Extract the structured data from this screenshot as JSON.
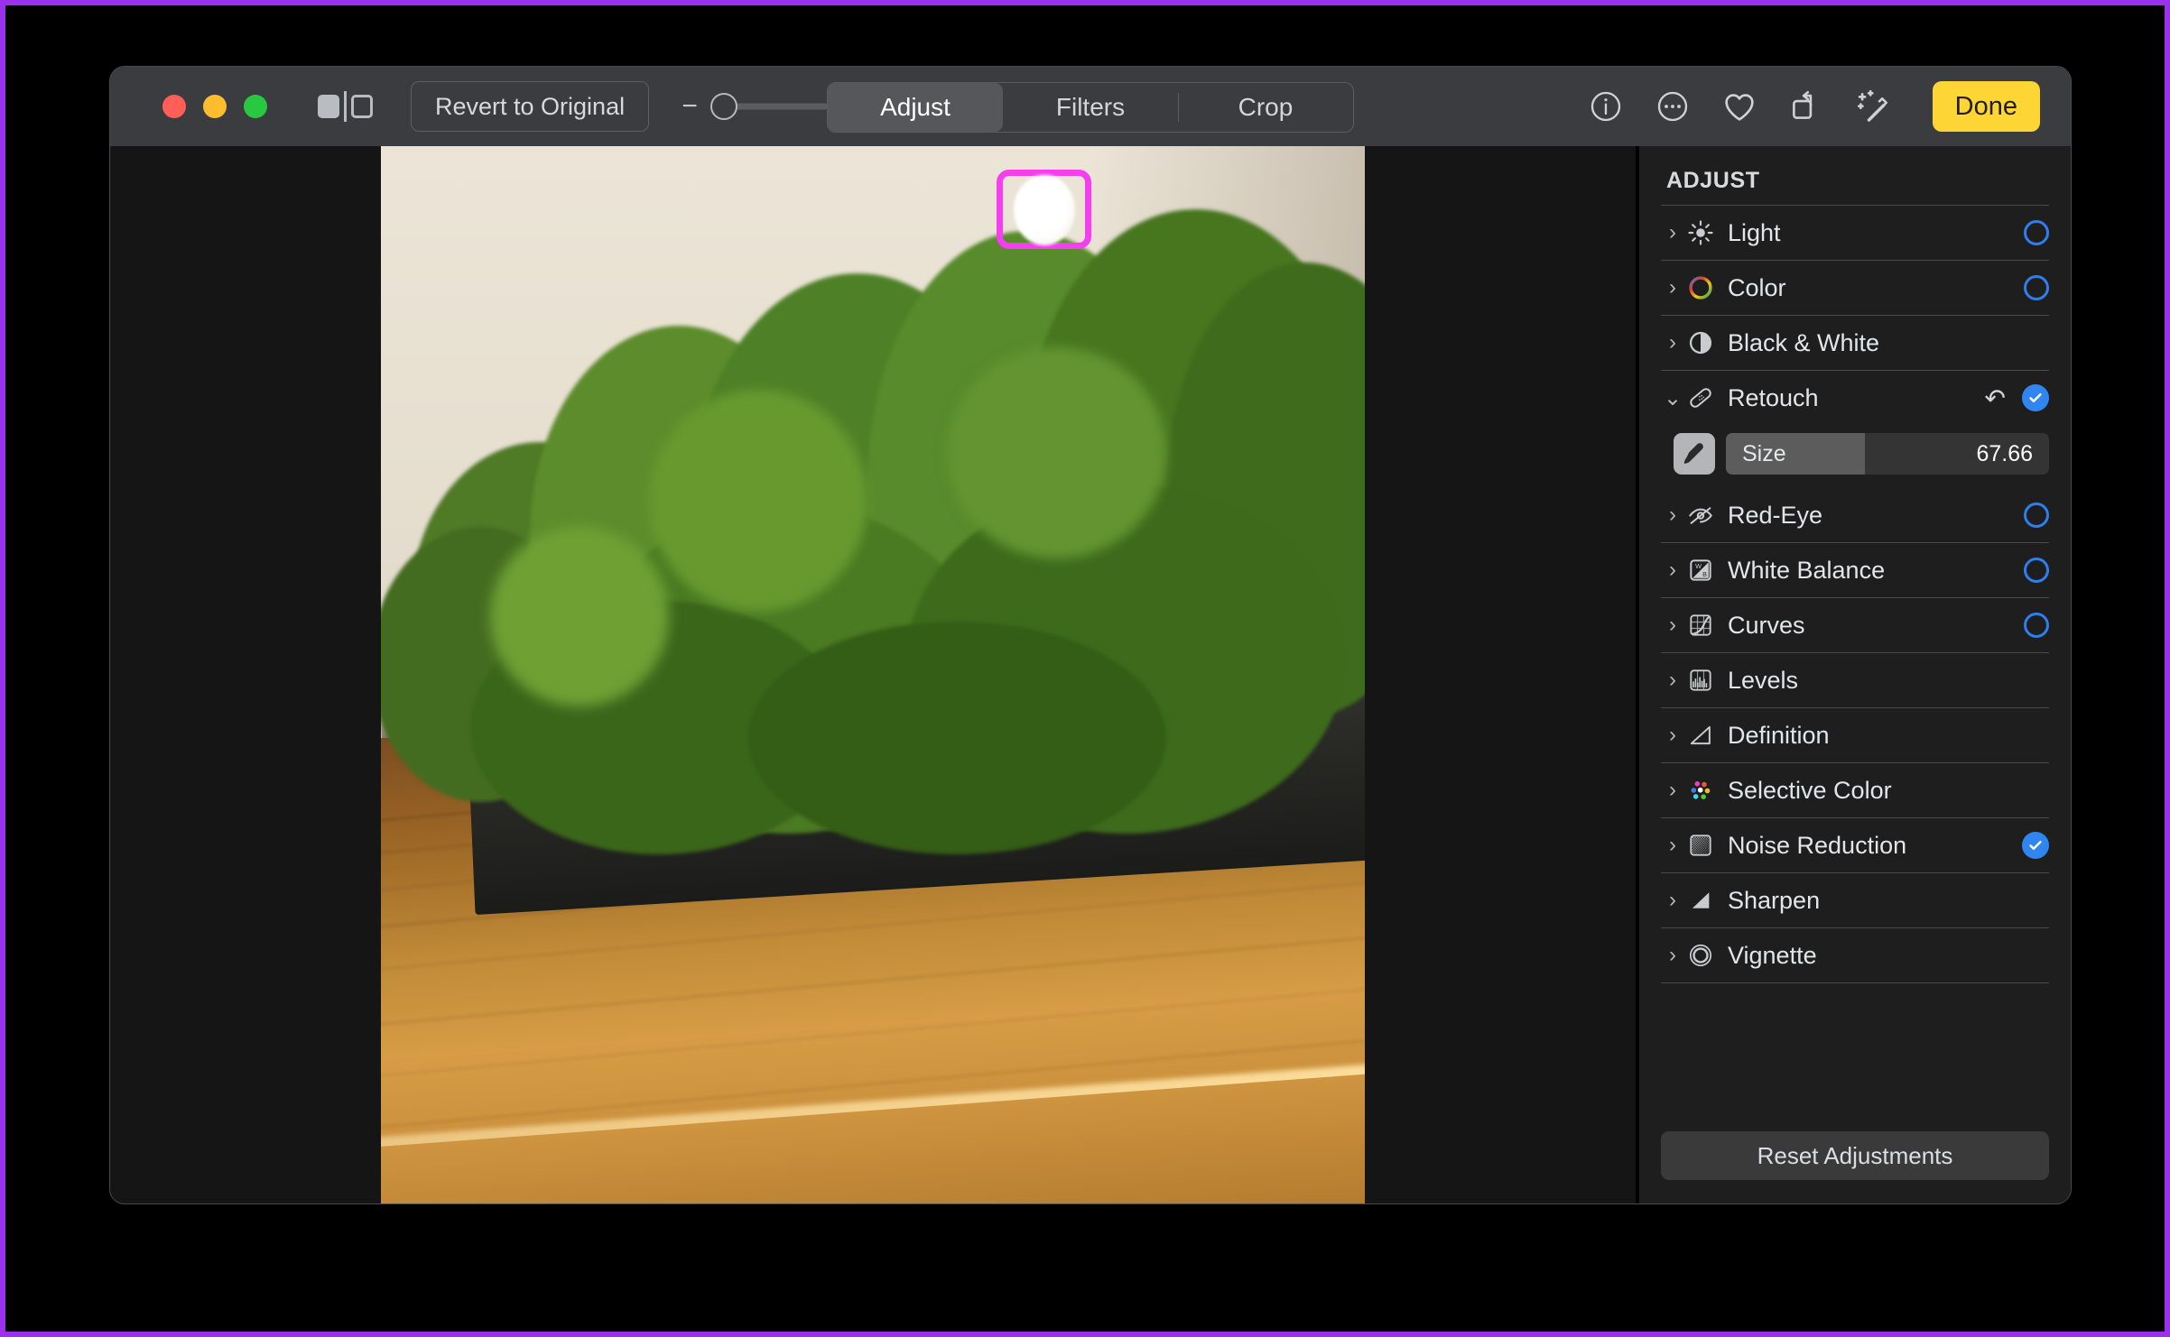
{
  "window": {
    "traffic_lights": [
      "close",
      "minimize",
      "zoom"
    ],
    "compare_icon": "before-after-compare-icon",
    "revert_label": "Revert to Original",
    "zoom_minus": "−",
    "zoom_plus": "+",
    "zoom_slider_position_pct": 0
  },
  "tabs": [
    {
      "label": "Adjust",
      "active": true
    },
    {
      "label": "Filters",
      "active": false
    },
    {
      "label": "Crop",
      "active": false
    }
  ],
  "toolbar_icons": [
    {
      "name": "info-icon"
    },
    {
      "name": "more-options-icon"
    },
    {
      "name": "favorite-heart-icon"
    },
    {
      "name": "rotate-icon"
    },
    {
      "name": "auto-enhance-icon"
    }
  ],
  "done_label": "Done",
  "sidebar": {
    "title": "ADJUST",
    "reset_label": "Reset Adjustments",
    "items": [
      {
        "label": "Light",
        "icon": "sun-icon",
        "expanded": false,
        "control": "circle-off"
      },
      {
        "label": "Color",
        "icon": "color-wheel-icon",
        "expanded": false,
        "control": "circle-off"
      },
      {
        "label": "Black & White",
        "icon": "black-white-icon",
        "expanded": false,
        "control": "none"
      },
      {
        "label": "Retouch",
        "icon": "bandage-icon",
        "expanded": true,
        "control": "circle-on",
        "has_revert": true
      },
      {
        "label": "Red-Eye",
        "icon": "eye-slash-icon",
        "expanded": false,
        "control": "circle-off"
      },
      {
        "label": "White Balance",
        "icon": "white-balance-icon",
        "expanded": false,
        "control": "circle-off"
      },
      {
        "label": "Curves",
        "icon": "curves-icon",
        "expanded": false,
        "control": "circle-off"
      },
      {
        "label": "Levels",
        "icon": "levels-icon",
        "expanded": false,
        "control": "none"
      },
      {
        "label": "Definition",
        "icon": "definition-icon",
        "expanded": false,
        "control": "none"
      },
      {
        "label": "Selective Color",
        "icon": "selective-color-icon",
        "expanded": false,
        "control": "none"
      },
      {
        "label": "Noise Reduction",
        "icon": "noise-reduction-icon",
        "expanded": false,
        "control": "circle-on"
      },
      {
        "label": "Sharpen",
        "icon": "sharpen-icon",
        "expanded": false,
        "control": "none"
      },
      {
        "label": "Vignette",
        "icon": "vignette-icon",
        "expanded": false,
        "control": "none"
      }
    ],
    "retouch": {
      "brush_icon": "paintbrush-icon",
      "size_label": "Size",
      "size_value": "67.66",
      "size_fill_pct": 43
    }
  },
  "photo": {
    "subject": "green preserved moss in a dark rectangular planter on a wooden table",
    "highlight_box_color": "#f53ef0",
    "brush_cursor": "retouch-brush-cursor"
  },
  "colors": {
    "page_border": "#9b30ee",
    "titlebar": "#3a3c40",
    "sidebar": "#1e1e1e",
    "canvas": "#151515",
    "accent_blue": "#2f86f0",
    "done_yellow": "#fdd535"
  }
}
